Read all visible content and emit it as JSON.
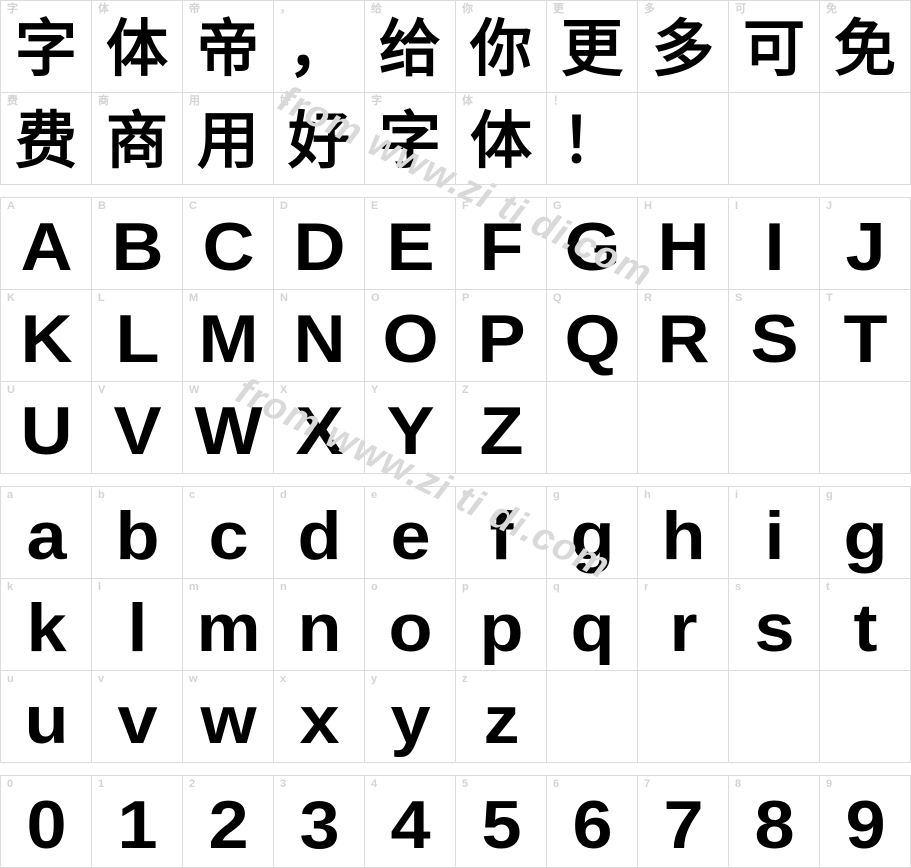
{
  "page": {
    "kind": "font-specimen-sheet",
    "background_color": "#ffffff",
    "grid_line_color": "#dcdcdc",
    "label_color": "#d4d4d4",
    "glyph_color": "#000000",
    "columns_per_row": 10
  },
  "watermarks": [
    {
      "text": "from www.zi ti di.com"
    },
    {
      "text": "from www.zi ti di.com"
    }
  ],
  "sections": [
    {
      "name": "chinese-sample-sentence",
      "sentence": "字体帝，给你更多可免费商用好字体！",
      "rows": [
        [
          {
            "label": "字",
            "glyph": "字",
            "type": "cjk"
          },
          {
            "label": "体",
            "glyph": "体",
            "type": "cjk"
          },
          {
            "label": "帝",
            "glyph": "帝",
            "type": "cjk"
          },
          {
            "label": "，",
            "glyph": "，",
            "type": "cjk"
          },
          {
            "label": "给",
            "glyph": "给",
            "type": "cjk"
          },
          {
            "label": "你",
            "glyph": "你",
            "type": "cjk"
          },
          {
            "label": "更",
            "glyph": "更",
            "type": "cjk"
          },
          {
            "label": "多",
            "glyph": "多",
            "type": "cjk"
          },
          {
            "label": "可",
            "glyph": "可",
            "type": "cjk"
          },
          {
            "label": "免",
            "glyph": "免",
            "type": "cjk"
          }
        ],
        [
          {
            "label": "费",
            "glyph": "费",
            "type": "cjk"
          },
          {
            "label": "商",
            "glyph": "商",
            "type": "cjk"
          },
          {
            "label": "用",
            "glyph": "用",
            "type": "cjk"
          },
          {
            "label": "好",
            "glyph": "好",
            "type": "cjk"
          },
          {
            "label": "字",
            "glyph": "字",
            "type": "cjk"
          },
          {
            "label": "体",
            "glyph": "体",
            "type": "cjk"
          },
          {
            "label": "！",
            "glyph": "！",
            "type": "cjk"
          },
          {
            "label": "",
            "glyph": "",
            "type": "empty"
          },
          {
            "label": "",
            "glyph": "",
            "type": "empty"
          },
          {
            "label": "",
            "glyph": "",
            "type": "empty"
          }
        ]
      ]
    },
    {
      "name": "uppercase-latin",
      "rows": [
        [
          {
            "label": "A",
            "glyph": "A",
            "type": "latin"
          },
          {
            "label": "B",
            "glyph": "B",
            "type": "latin"
          },
          {
            "label": "C",
            "glyph": "C",
            "type": "latin"
          },
          {
            "label": "D",
            "glyph": "D",
            "type": "latin"
          },
          {
            "label": "E",
            "glyph": "E",
            "type": "latin"
          },
          {
            "label": "F",
            "glyph": "F",
            "type": "latin"
          },
          {
            "label": "G",
            "glyph": "G",
            "type": "latin"
          },
          {
            "label": "H",
            "glyph": "H",
            "type": "latin"
          },
          {
            "label": "I",
            "glyph": "I",
            "type": "latin"
          },
          {
            "label": "J",
            "glyph": "J",
            "type": "latin"
          }
        ],
        [
          {
            "label": "K",
            "glyph": "K",
            "type": "latin"
          },
          {
            "label": "L",
            "glyph": "L",
            "type": "latin"
          },
          {
            "label": "M",
            "glyph": "M",
            "type": "latin"
          },
          {
            "label": "N",
            "glyph": "N",
            "type": "latin"
          },
          {
            "label": "O",
            "glyph": "O",
            "type": "latin"
          },
          {
            "label": "P",
            "glyph": "P",
            "type": "latin"
          },
          {
            "label": "Q",
            "glyph": "Q",
            "type": "latin"
          },
          {
            "label": "R",
            "glyph": "R",
            "type": "latin"
          },
          {
            "label": "S",
            "glyph": "S",
            "type": "latin"
          },
          {
            "label": "T",
            "glyph": "T",
            "type": "latin"
          }
        ],
        [
          {
            "label": "U",
            "glyph": "U",
            "type": "latin"
          },
          {
            "label": "V",
            "glyph": "V",
            "type": "latin"
          },
          {
            "label": "W",
            "glyph": "W",
            "type": "latin"
          },
          {
            "label": "X",
            "glyph": "X",
            "type": "latin"
          },
          {
            "label": "Y",
            "glyph": "Y",
            "type": "latin"
          },
          {
            "label": "Z",
            "glyph": "Z",
            "type": "latin"
          },
          {
            "label": "",
            "glyph": "",
            "type": "empty"
          },
          {
            "label": "",
            "glyph": "",
            "type": "empty"
          },
          {
            "label": "",
            "glyph": "",
            "type": "empty"
          },
          {
            "label": "",
            "glyph": "",
            "type": "empty"
          }
        ]
      ]
    },
    {
      "name": "lowercase-latin",
      "rows": [
        [
          {
            "label": "a",
            "glyph": "a",
            "type": "latin"
          },
          {
            "label": "b",
            "glyph": "b",
            "type": "latin"
          },
          {
            "label": "c",
            "glyph": "c",
            "type": "latin"
          },
          {
            "label": "d",
            "glyph": "d",
            "type": "latin"
          },
          {
            "label": "e",
            "glyph": "e",
            "type": "latin"
          },
          {
            "label": "f",
            "glyph": "f",
            "type": "latin"
          },
          {
            "label": "g",
            "glyph": "g",
            "type": "latin"
          },
          {
            "label": "h",
            "glyph": "h",
            "type": "latin"
          },
          {
            "label": "i",
            "glyph": "i",
            "type": "latin"
          },
          {
            "label": "g",
            "glyph": "g",
            "type": "latin"
          }
        ],
        [
          {
            "label": "k",
            "glyph": "k",
            "type": "latin"
          },
          {
            "label": "l",
            "glyph": "l",
            "type": "latin"
          },
          {
            "label": "m",
            "glyph": "m",
            "type": "latin"
          },
          {
            "label": "n",
            "glyph": "n",
            "type": "latin"
          },
          {
            "label": "o",
            "glyph": "o",
            "type": "latin"
          },
          {
            "label": "p",
            "glyph": "p",
            "type": "latin"
          },
          {
            "label": "q",
            "glyph": "q",
            "type": "latin"
          },
          {
            "label": "r",
            "glyph": "r",
            "type": "latin"
          },
          {
            "label": "s",
            "glyph": "s",
            "type": "latin"
          },
          {
            "label": "t",
            "glyph": "t",
            "type": "latin"
          }
        ],
        [
          {
            "label": "u",
            "glyph": "u",
            "type": "latin"
          },
          {
            "label": "v",
            "glyph": "v",
            "type": "latin"
          },
          {
            "label": "w",
            "glyph": "w",
            "type": "latin"
          },
          {
            "label": "x",
            "glyph": "x",
            "type": "latin"
          },
          {
            "label": "y",
            "glyph": "y",
            "type": "latin"
          },
          {
            "label": "z",
            "glyph": "z",
            "type": "latin"
          },
          {
            "label": "",
            "glyph": "",
            "type": "empty"
          },
          {
            "label": "",
            "glyph": "",
            "type": "empty"
          },
          {
            "label": "",
            "glyph": "",
            "type": "empty"
          },
          {
            "label": "",
            "glyph": "",
            "type": "empty"
          }
        ]
      ]
    },
    {
      "name": "digits",
      "rows": [
        [
          {
            "label": "0",
            "glyph": "0",
            "type": "latin"
          },
          {
            "label": "1",
            "glyph": "1",
            "type": "latin"
          },
          {
            "label": "2",
            "glyph": "2",
            "type": "latin"
          },
          {
            "label": "3",
            "glyph": "3",
            "type": "latin"
          },
          {
            "label": "4",
            "glyph": "4",
            "type": "latin"
          },
          {
            "label": "5",
            "glyph": "5",
            "type": "latin"
          },
          {
            "label": "6",
            "glyph": "6",
            "type": "latin"
          },
          {
            "label": "7",
            "glyph": "7",
            "type": "latin"
          },
          {
            "label": "8",
            "glyph": "8",
            "type": "latin"
          },
          {
            "label": "9",
            "glyph": "9",
            "type": "latin"
          }
        ]
      ]
    }
  ]
}
